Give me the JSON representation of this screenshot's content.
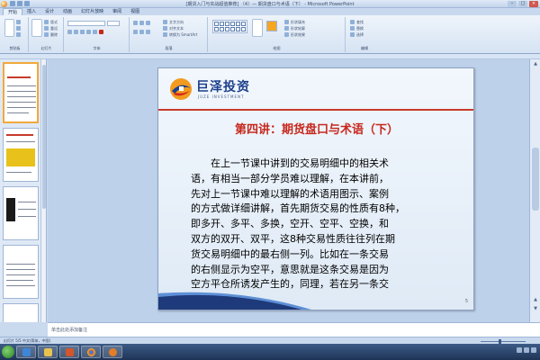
{
  "window": {
    "title": "[期货入门与实战超值推荐] （4）— 期货盘口与术语（下） - Microsoft PowerPoint",
    "minimize": "–",
    "maximize": "□",
    "close": "×"
  },
  "ribbon": {
    "tabs": [
      "开始",
      "插入",
      "设计",
      "动画",
      "幻灯片放映",
      "审阅",
      "视图"
    ],
    "active_tab_index": 0,
    "groups": {
      "clipboard": "剪贴板",
      "slides": "幻灯片",
      "font": "字体",
      "paragraph": "段落",
      "drawing": "绘图",
      "editing": "编辑"
    },
    "commands": {
      "paste": "粘贴",
      "new_slide": "新建幻灯片",
      "layout": "版式",
      "reset": "重设",
      "delete": "删除",
      "text_direction": "文字方向",
      "align_text": "对齐文本",
      "smartart": "转换为 SmartArt",
      "arrange": "排列",
      "quick_styles": "快速样式",
      "shape_fill": "形状填充",
      "shape_outline": "形状轮廓",
      "shape_effects": "形状效果",
      "find": "查找",
      "replace": "替换",
      "select": "选择"
    }
  },
  "slide": {
    "logo": {
      "name": "巨泽投资",
      "subtitle": "JUZE INVESTMENT"
    },
    "title": "第四讲：期货盘口与术语（下）",
    "body_lines": [
      "　　在上一节课中讲到的交易明细中的相关术",
      "语，有相当一部分学员难以理解，在本讲前，",
      "先对上一节课中难以理解的术语用图示、案例",
      "的方式做详细讲解，首先期货交易的性质有8种，",
      "即多开、多平、多换，空开、空平、空换，和",
      "双方的双开、双平，这8种交易性质往往列在期",
      "货交易明细中的最右侧一列。比如在一条交易",
      "的右侧显示为空平，意思就是这条交易是因为",
      "空方平仓所诱发产生的，同理，若在另一条交"
    ],
    "page_number": "5"
  },
  "notes": {
    "placeholder": "单击此处添加备注"
  },
  "statusbar": {
    "text": "幻灯片 5/5   中文(简体，中国)"
  },
  "colors": {
    "accent_red": "#c7271c",
    "logo_blue": "#1b3f8b",
    "ribbon_bg": "#d6e3f3",
    "taskbar": "#1e3456"
  },
  "icons": {
    "taskbar_apps": [
      "start-orb",
      "ie",
      "folder",
      "powerpoint",
      "chrome",
      "media"
    ]
  }
}
